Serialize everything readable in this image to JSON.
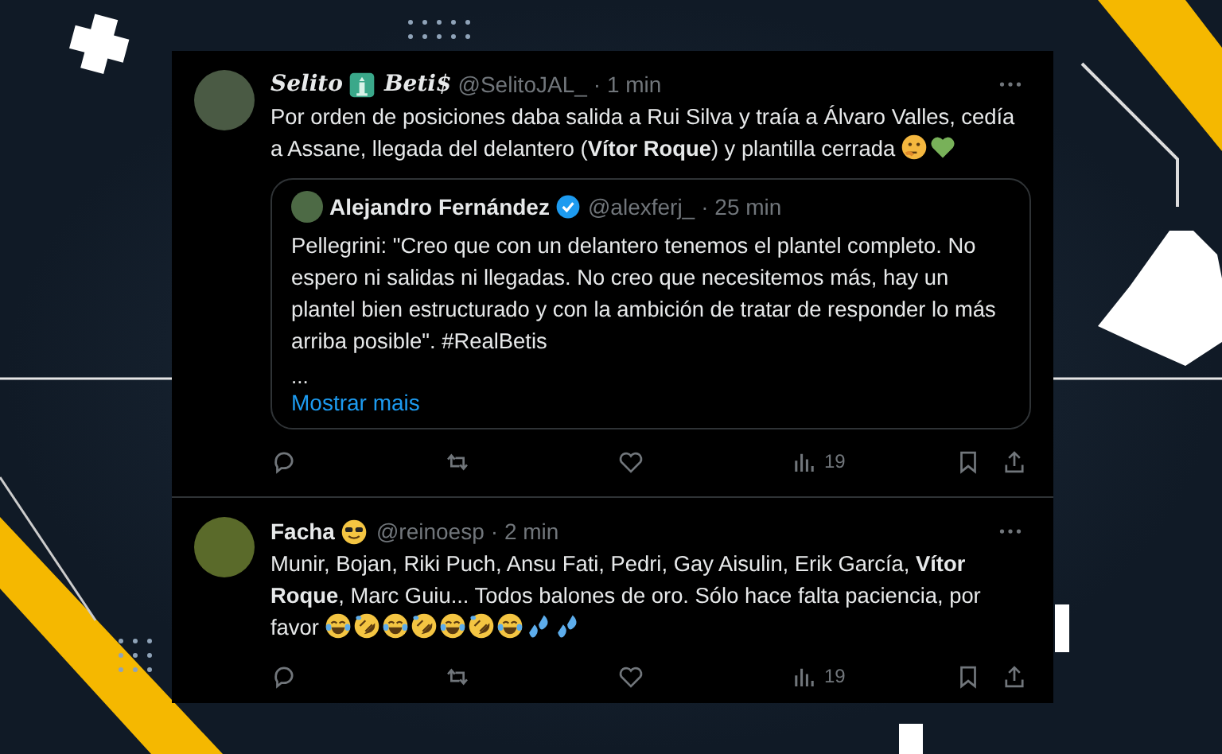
{
  "tweets": [
    {
      "name": "Selito",
      "name_suffix": "Beti$",
      "handle": "@SelitoJAL_",
      "time": "· 1 min",
      "text": "Por orden de posiciones daba salida a Rui Silva y traía a Álvaro Valles, cedía a Assane, llegada del delantero (**Vítor Roque**) y plantilla cerrada",
      "emojis": [
        {
          "kind": "thinking"
        },
        {
          "kind": "green-heart"
        }
      ],
      "quote": {
        "name": "Alejandro Fernández",
        "verified": true,
        "handle": "@alexferj_",
        "time": "· 25 min",
        "text": "Pellegrini: \"Creo que con un delantero tenemos el plantel completo. No espero ni salidas ni llegadas. No creo que necesitemos más, hay un plantel bien estructurado y con la ambición de tratar de responder lo más arriba posible\". #RealBetis",
        "ellipsis": "...",
        "more": "Mostrar mais"
      },
      "views": "19"
    },
    {
      "name": "Facha",
      "handle": "@reinoesp",
      "time": "· 2 min",
      "name_emojis": [
        {
          "kind": "sunglasses"
        }
      ],
      "text": "Munir, Bojan, Riki Puch, Ansu Fati, Pedri, Gay Aisulin, Erik García, **Vítor Roque**, Marc Guiu... Todos balones de oro. Sólo hace falta paciencia, por favor",
      "emojis": [
        {
          "kind": "tears-of-joy"
        },
        {
          "kind": "rofl"
        },
        {
          "kind": "tears-of-joy"
        },
        {
          "kind": "rofl"
        },
        {
          "kind": "tears-of-joy"
        },
        {
          "kind": "rofl"
        },
        {
          "kind": "tears-of-joy"
        },
        {
          "kind": "sweat-drops"
        },
        {
          "kind": "sweat-drops"
        }
      ],
      "views": "19"
    }
  ]
}
